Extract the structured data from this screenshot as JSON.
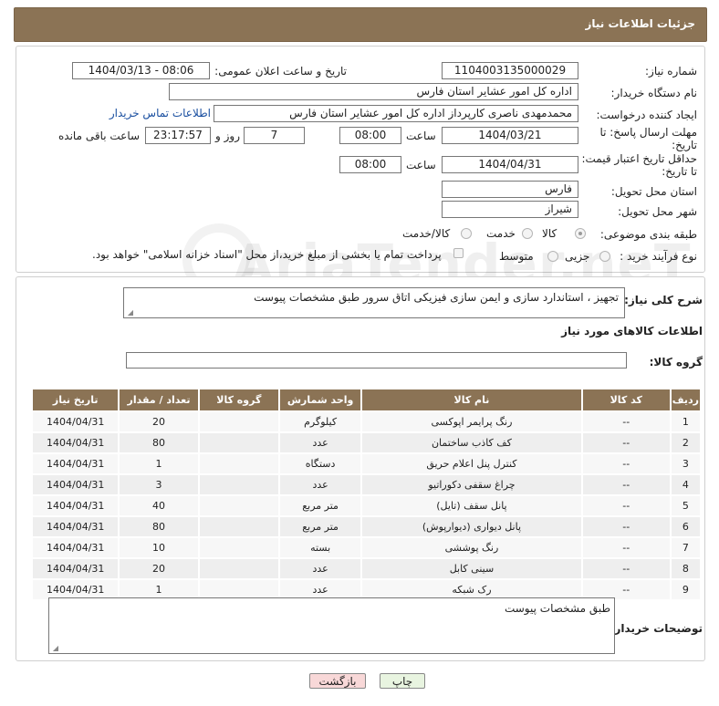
{
  "header": {
    "title": "جزئیات اطلاعات نیاز"
  },
  "form": {
    "need_number_label": "شماره نیاز:",
    "need_number": "1104003135000029",
    "announce_label": "تاریخ و ساعت اعلان عمومی:",
    "announce_value": "1404/03/13 - 08:06",
    "buyer_org_label": "نام دستگاه خریدار:",
    "buyer_org": "اداره کل امور عشایر استان فارس",
    "creator_label": "ایجاد کننده درخواست:",
    "creator": "محمدمهدی ناصری کارپرداز اداره کل امور عشایر استان فارس",
    "contact_link": "اطلاعات تماس خریدار",
    "reply_deadline_label": "مهلت ارسال پاسخ: تا تاریخ:",
    "reply_date": "1404/03/21",
    "time_label": "ساعت",
    "reply_time": "08:00",
    "days_value": "7",
    "days_label": "روز و",
    "remaining_time": "23:17:57",
    "remaining_label": "ساعت باقی مانده",
    "price_validity_label": "حداقل تاریخ اعتبار قیمت: تا تاریخ:",
    "validity_date": "1404/04/31",
    "validity_time": "08:00",
    "province_label": "استان محل تحویل:",
    "province": "فارس",
    "city_label": "شهر محل تحویل:",
    "city": "شیراز",
    "category_label": "طبقه بندی موضوعی:",
    "category_options": [
      "کالا",
      "خدمت",
      "کالا/خدمت"
    ],
    "process_label": "نوع فرآیند خرید :",
    "process_options": [
      "جزیی",
      "متوسط"
    ],
    "payment_note": "پرداخت تمام یا بخشی از مبلغ خرید،از محل \"اسناد خزانه اسلامی\" خواهد بود."
  },
  "details": {
    "description_label": "شرح کلی نیاز:",
    "description": "تجهیز ، استاندارد سازی و ایمن سازی فیزیکی اتاق سرور طبق مشخصات پیوست",
    "goods_info_title": "اطلاعات کالاهای مورد نیاز",
    "goods_group_label": "گروه کالا:",
    "goods_group_value": "",
    "buyer_notes_label": "توضیحات خریدار:",
    "buyer_notes": "طبق مشخصات پیوست"
  },
  "table": {
    "headers": [
      "ردیف",
      "کد کالا",
      "نام کالا",
      "واحد شمارش",
      "گروه کالا",
      "تعداد / مقدار",
      "تاریخ نیاز"
    ],
    "rows": [
      [
        "1",
        "--",
        "رنگ پرایمر اپوکسی",
        "کیلوگرم",
        "",
        "20",
        "1404/04/31"
      ],
      [
        "2",
        "--",
        "کف کاذب ساختمان",
        "عدد",
        "",
        "80",
        "1404/04/31"
      ],
      [
        "3",
        "--",
        "کنترل پنل اعلام حریق",
        "دستگاه",
        "",
        "1",
        "1404/04/31"
      ],
      [
        "4",
        "--",
        "چراغ سقفی دکوراتیو",
        "عدد",
        "",
        "3",
        "1404/04/31"
      ],
      [
        "5",
        "--",
        "پانل سقف (تایل)",
        "متر مربع",
        "",
        "40",
        "1404/04/31"
      ],
      [
        "6",
        "--",
        "پانل دیواری (دیوارپوش)",
        "متر مربع",
        "",
        "80",
        "1404/04/31"
      ],
      [
        "7",
        "--",
        "رنگ پوششی",
        "بسته",
        "",
        "10",
        "1404/04/31"
      ],
      [
        "8",
        "--",
        "سینی کابل",
        "عدد",
        "",
        "20",
        "1404/04/31"
      ],
      [
        "9",
        "--",
        "رک شبکه",
        "عدد",
        "",
        "1",
        "1404/04/31"
      ]
    ]
  },
  "buttons": {
    "print": "چاپ",
    "back": "بازگشت"
  },
  "watermark": "AriaTender.neT",
  "colors": {
    "header_bg": "#8b7355",
    "link": "#1a4fa0",
    "back_button_bg": "#f8d8d8",
    "print_button_bg": "#e8f4e0"
  }
}
